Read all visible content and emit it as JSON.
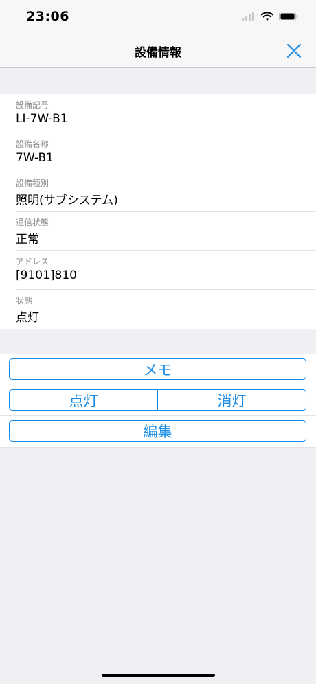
{
  "status_bar": {
    "time": "23:06"
  },
  "nav": {
    "title": "設備情報",
    "close_icon": "close-icon"
  },
  "info": [
    {
      "label": "設備記号",
      "value": "LI-7W-B1"
    },
    {
      "label": "設備名称",
      "value": "7W-B1"
    },
    {
      "label": "設備種別",
      "value": "照明(サブシステム)"
    },
    {
      "label": "通信状態",
      "value": "正常"
    },
    {
      "label": "アドレス",
      "value": "[9101]810"
    },
    {
      "label": "状態",
      "value": "点灯"
    }
  ],
  "buttons": {
    "memo": "メモ",
    "light_on": "点灯",
    "light_off": "消灯",
    "edit": "編集"
  },
  "colors": {
    "accent": "#1a8ce6",
    "background": "#efeff4"
  }
}
